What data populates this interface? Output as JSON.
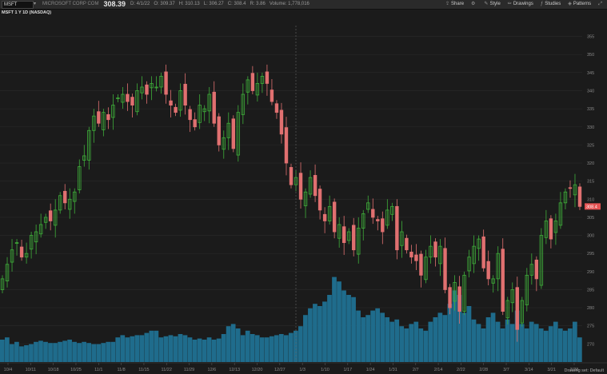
{
  "toolbar": {
    "symbol": "MSFT",
    "company": "MICROSOFT CORP COM",
    "last_price": "308.39",
    "quote_items": [
      "D: 4/1/22",
      "O: 309.37",
      "H: 310.13",
      "L: 306.27",
      "C: 308.4",
      "R: 3.86",
      "Volume: 1,778,016"
    ],
    "buttons": {
      "share": "Share",
      "style": "Style",
      "drawings": "Drawings",
      "studies": "Studies",
      "patterns": "Patterns"
    }
  },
  "study_label": "MSFT 1 Y 1D (NASDAQ)",
  "price_label": "308.4",
  "status": "Drawing set: Default",
  "colors": {
    "bg": "#1b1b1b",
    "up": "#3fae3a",
    "down": "#e07070",
    "volume": "#1f6c8c",
    "grid": "#2a2a2a",
    "label": "#e55353"
  },
  "chart_data": {
    "type": "candlestick",
    "ylim": [
      265,
      358
    ],
    "y_ticks": [
      270,
      275,
      280,
      285,
      290,
      295,
      300,
      305,
      310,
      315,
      320,
      325,
      330,
      335,
      340,
      345,
      350,
      355
    ],
    "x_tick_labels": [
      "10/4",
      "10/11",
      "10/18",
      "10/25",
      "11/1",
      "11/8",
      "11/15",
      "11/22",
      "11/29",
      "12/6",
      "12/13",
      "12/20",
      "12/27",
      "1/3",
      "1/10",
      "1/17",
      "1/24",
      "1/31",
      "2/7",
      "2/14",
      "2/22",
      "2/28",
      "3/7",
      "3/14",
      "3/21",
      "3/28"
    ],
    "closes": [
      288,
      292,
      296,
      298,
      294,
      295,
      300,
      301,
      303,
      305,
      304,
      307,
      311,
      309,
      310,
      312,
      319,
      322,
      329,
      333,
      331,
      334,
      332,
      336,
      338,
      339,
      337,
      336,
      340,
      341,
      339,
      342,
      341,
      344,
      339,
      336,
      334,
      340,
      336,
      332,
      330,
      336,
      335,
      339,
      331,
      325,
      327,
      331,
      324,
      334,
      339,
      343,
      340,
      342,
      344,
      342,
      337,
      334,
      328,
      320,
      314,
      316,
      310,
      312,
      316,
      311,
      307,
      304,
      308,
      301,
      303,
      298,
      301,
      296,
      302,
      306,
      309,
      305,
      304,
      301,
      307,
      308,
      296,
      301,
      296,
      294,
      293,
      289,
      294,
      297,
      294,
      297,
      285,
      280,
      287,
      279,
      289,
      294,
      297,
      299,
      291,
      288,
      288,
      295,
      279,
      282,
      285,
      274,
      282,
      289,
      292,
      288,
      300,
      304,
      299,
      304,
      309,
      312,
      313,
      314,
      308
    ],
    "volume_ylim": [
      0,
      100
    ],
    "volumes": [
      20,
      22,
      16,
      18,
      14,
      15,
      16,
      18,
      19,
      18,
      17,
      17,
      18,
      19,
      20,
      18,
      17,
      18,
      17,
      16,
      16,
      17,
      18,
      18,
      22,
      24,
      22,
      23,
      24,
      24,
      26,
      28,
      28,
      22,
      23,
      24,
      23,
      25,
      24,
      22,
      20,
      21,
      20,
      22,
      20,
      21,
      25,
      32,
      34,
      30,
      24,
      28,
      25,
      24,
      22,
      22,
      23,
      24,
      25,
      24,
      26,
      28,
      32,
      42,
      48,
      52,
      50,
      54,
      60,
      76,
      72,
      64,
      60,
      58,
      46,
      40,
      42,
      46,
      48,
      44,
      40,
      36,
      38,
      32,
      30,
      34,
      36,
      30,
      28,
      36,
      40,
      44,
      42,
      52,
      64,
      60,
      44,
      50,
      38,
      34,
      30,
      40,
      44,
      36,
      30,
      38,
      34,
      46,
      34,
      30,
      36,
      34,
      30,
      28,
      32,
      36,
      30,
      28,
      30,
      36,
      22
    ]
  }
}
